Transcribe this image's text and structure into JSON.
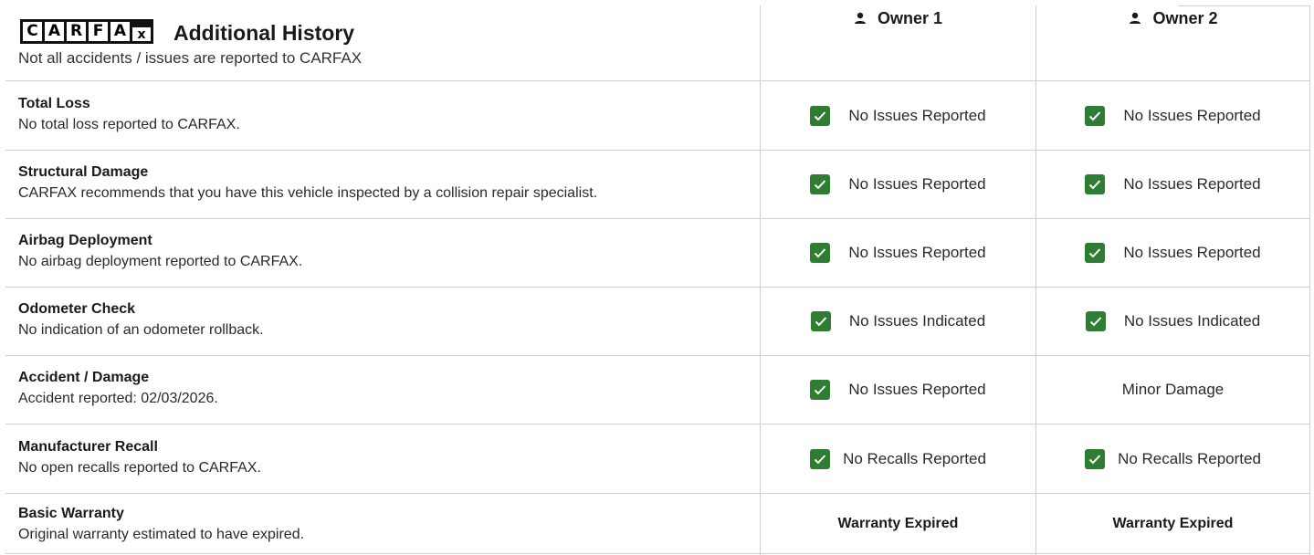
{
  "header": {
    "logo_letters": [
      "C",
      "A",
      "R",
      "F",
      "A",
      "x"
    ],
    "title": "Additional History",
    "subtitle": "Not all accidents / issues are reported to CARFAX"
  },
  "owners": [
    {
      "label": "Owner 1",
      "icon": "person-icon"
    },
    {
      "label": "Owner 2",
      "icon": "person-icon"
    }
  ],
  "colors": {
    "check": "#2e7d32",
    "divider": "#cfcfcf"
  },
  "rows": [
    {
      "title": "Total Loss",
      "desc": "No total loss reported to CARFAX.",
      "owner1": {
        "text": "No Issues Reported",
        "check": true
      },
      "owner2": {
        "text": "No Issues Reported",
        "check": true
      }
    },
    {
      "title": "Structural Damage",
      "desc": "CARFAX recommends that you have this vehicle inspected by a collision repair specialist.",
      "owner1": {
        "text": "No Issues Reported",
        "check": true
      },
      "owner2": {
        "text": "No Issues Reported",
        "check": true
      }
    },
    {
      "title": "Airbag Deployment",
      "desc": "No airbag deployment reported to CARFAX.",
      "owner1": {
        "text": "No Issues Reported",
        "check": true
      },
      "owner2": {
        "text": "No Issues Reported",
        "check": true
      }
    },
    {
      "title": "Odometer Check",
      "desc": "No indication of an odometer rollback.",
      "owner1": {
        "text": "No Issues Indicated",
        "check": true
      },
      "owner2": {
        "text": "No Issues Indicated",
        "check": true
      }
    },
    {
      "title": "Accident / Damage",
      "desc": "Accident reported: 02/03/2026.",
      "owner1": {
        "text": "No Issues Reported",
        "check": true
      },
      "owner2": {
        "text": "Minor Damage",
        "check": false
      }
    },
    {
      "title": "Manufacturer Recall",
      "desc": "No open recalls reported to CARFAX.",
      "owner1": {
        "text": "No Recalls Reported",
        "check": true
      },
      "owner2": {
        "text": "No Recalls Reported",
        "check": true
      }
    },
    {
      "title": "Basic Warranty",
      "desc": "Original warranty estimated to have expired.",
      "owner1": {
        "text": "Warranty Expired",
        "check": false,
        "bold": true
      },
      "owner2": {
        "text": "Warranty Expired",
        "check": false,
        "bold": true
      }
    }
  ]
}
